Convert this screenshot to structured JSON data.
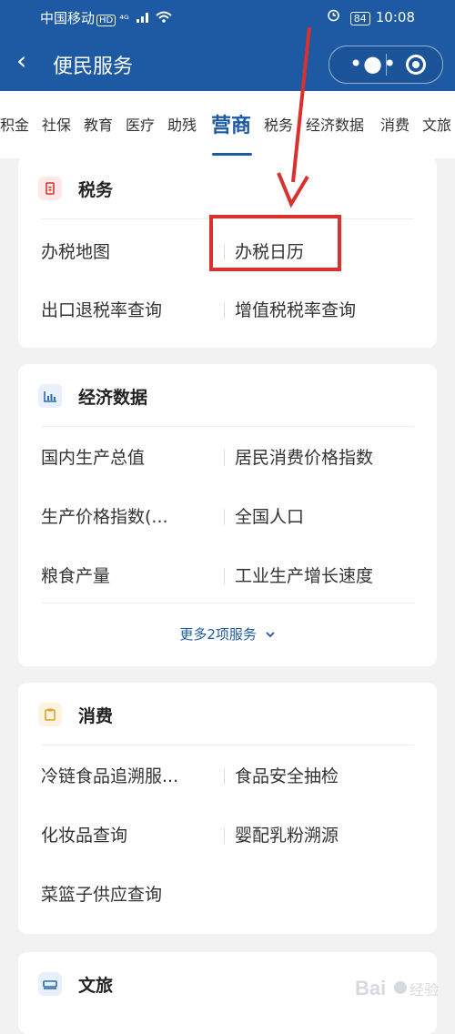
{
  "status_bar": {
    "carrier": "中国移动",
    "hd": "HD",
    "network": "⁴ᴳ",
    "battery": "84",
    "time": "10:08"
  },
  "nav": {
    "back_icon": "chevron-left-icon",
    "title": "便民服务",
    "more_icon": "more-dots-icon",
    "close_icon": "record-circle-icon"
  },
  "tabs": [
    "积金",
    "社保",
    "教育",
    "医疗",
    "助残",
    "营商",
    "税务",
    "经济数据",
    "消费",
    "文旅"
  ],
  "active_tab": "营商",
  "sections": [
    {
      "title": "税务",
      "icon": "tax-icon",
      "items": [
        "办税地图",
        "办税日历",
        "出口退税率查询",
        "增值税税率查询"
      ]
    },
    {
      "title": "经济数据",
      "icon": "bar-chart-icon",
      "items": [
        "国内生产总值",
        "居民消费价格指数",
        "生产价格指数(...",
        "全国人口",
        "粮食产量",
        "工业生产增长速度"
      ],
      "more": "更多2项服务"
    },
    {
      "title": "消费",
      "icon": "clipboard-icon",
      "items": [
        "冷链食品追溯服...",
        "食品安全抽检",
        "化妆品查询",
        "婴配乳粉溯源",
        "菜篮子供应查询"
      ]
    },
    {
      "title": "文旅",
      "icon": "bed-icon",
      "items": []
    }
  ],
  "colors": {
    "brand": "#1e5aa3",
    "annotation": "#d8312e",
    "tax_icon": "#d8312e",
    "chart_icon": "#2b6cb0",
    "clipboard_icon": "#e0a12b",
    "bed_icon": "#2b6cb0"
  },
  "watermark": {
    "text": "Bai 经验"
  }
}
